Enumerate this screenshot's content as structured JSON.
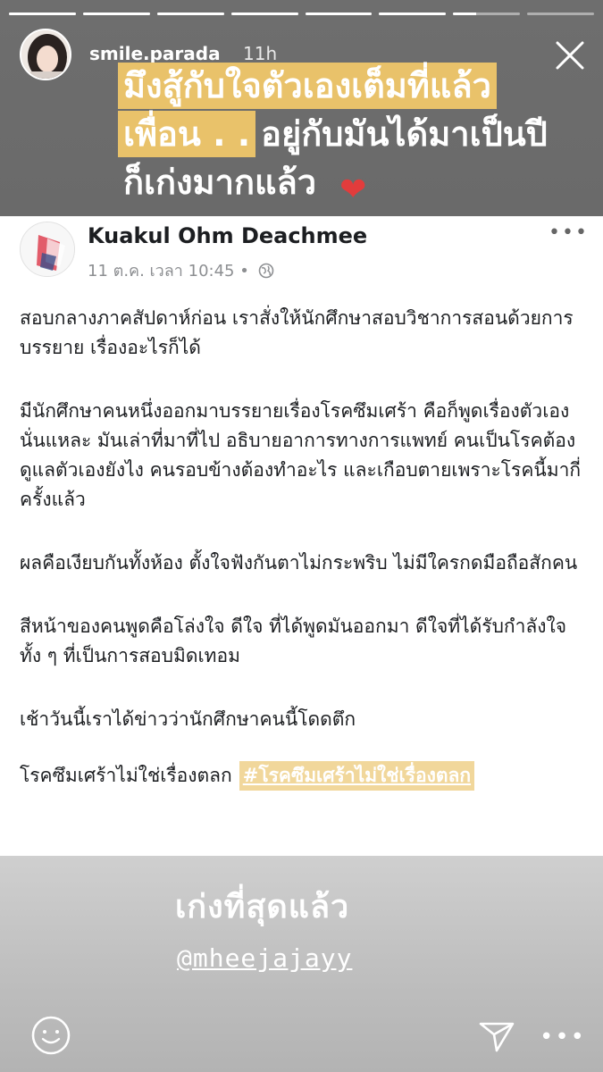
{
  "story": {
    "progress_segments": [
      1,
      1,
      1,
      1,
      1,
      1,
      0.35,
      0
    ],
    "username": "smile.parada",
    "time": "11h"
  },
  "caption": {
    "line1": "มึงสู้กับใจตัวเองเต็มที่แล้ว",
    "line2a": "เพื่อน . .",
    "line2b": "อยู่กับมันได้มาเป็นปี",
    "line3": "ก็เก่งมากแล้ว",
    "heart": "❤"
  },
  "post": {
    "author": "Kuakul Ohm Deachmee",
    "meta": "11 ต.ค. เวลา 10:45 •",
    "more": "•••",
    "paragraphs": [
      "สอบกลางภาคสัปดาห์ก่อน เราสั่งให้นักศึกษาสอบวิชาการสอนด้วยการบรรยาย เรื่องอะไรก็ได้",
      "มีนักศึกษาคนหนึ่งออกมาบรรยายเรื่องโรคซึมเศร้า คือก็พูดเรื่องตัวเองนั่นแหละ มันเล่าที่มาที่ไป อธิบายอาการทางการแพทย์ คนเป็นโรคต้องดูแลตัวเองยังไง คนรอบข้างต้องทำอะไร และเกือบตายเพราะโรคนี้มากี่ครั้งแล้ว",
      "ผลคือเงียบกันทั้งห้อง ตั้งใจฟังกันตาไม่กระพริบ ไม่มีใครกดมือถือสักคน",
      "สีหน้าของคนพูดคือโล่งใจ ดีใจ ที่ได้พูดมันออกมา ดีใจที่ได้รับกำลังใจ ทั้ง ๆ ที่เป็นการสอบมิดเทอม",
      "เช้าวันนี้เราได้ข่าวว่านักศึกษาคนนี้โดดตึก"
    ],
    "last_line": "โรคซึมเศร้าไม่ใช่เรื่องตลก",
    "hashtag": "#โรคซึมเศร้าไม่ใช่เรื่องตลก"
  },
  "bottom": {
    "text": "เก่งที่สุดแล้ว",
    "mention": "@mheejajayy"
  },
  "footer": {
    "more": "•••"
  }
}
